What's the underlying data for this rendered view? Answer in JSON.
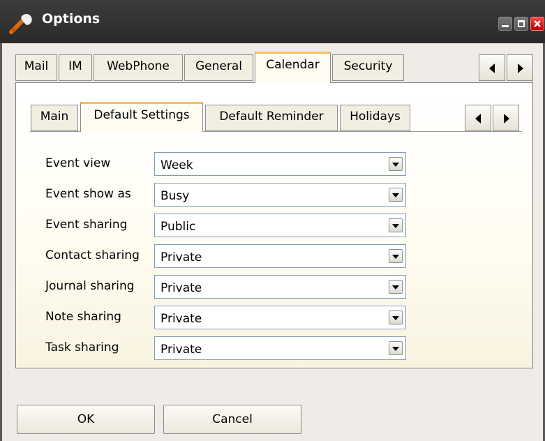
{
  "window": {
    "title": "Options",
    "icon": "wrench-icon"
  },
  "top_tabs": [
    {
      "label": "Mail",
      "active": false
    },
    {
      "label": "IM",
      "active": false
    },
    {
      "label": "WebPhone",
      "active": false
    },
    {
      "label": "General",
      "active": false
    },
    {
      "label": "Calendar",
      "active": true
    },
    {
      "label": "Security",
      "active": false
    }
  ],
  "sub_tabs": [
    {
      "label": "Main",
      "active": false
    },
    {
      "label": "Default Settings",
      "active": true
    },
    {
      "label": "Default Reminder",
      "active": false
    },
    {
      "label": "Holidays",
      "active": false
    }
  ],
  "settings": [
    {
      "label": "Event view",
      "value": "Week"
    },
    {
      "label": "Event show as",
      "value": "Busy"
    },
    {
      "label": "Event sharing",
      "value": "Public"
    },
    {
      "label": "Contact sharing",
      "value": "Private"
    },
    {
      "label": "Journal sharing",
      "value": "Private"
    },
    {
      "label": "Note sharing",
      "value": "Private"
    },
    {
      "label": "Task sharing",
      "value": "Private"
    }
  ],
  "buttons": {
    "ok": "OK",
    "cancel": "Cancel"
  },
  "colors": {
    "titlebar": "#2f2f2f",
    "active_tab_accent": "#f4c060",
    "close_button": "#cc1111"
  }
}
